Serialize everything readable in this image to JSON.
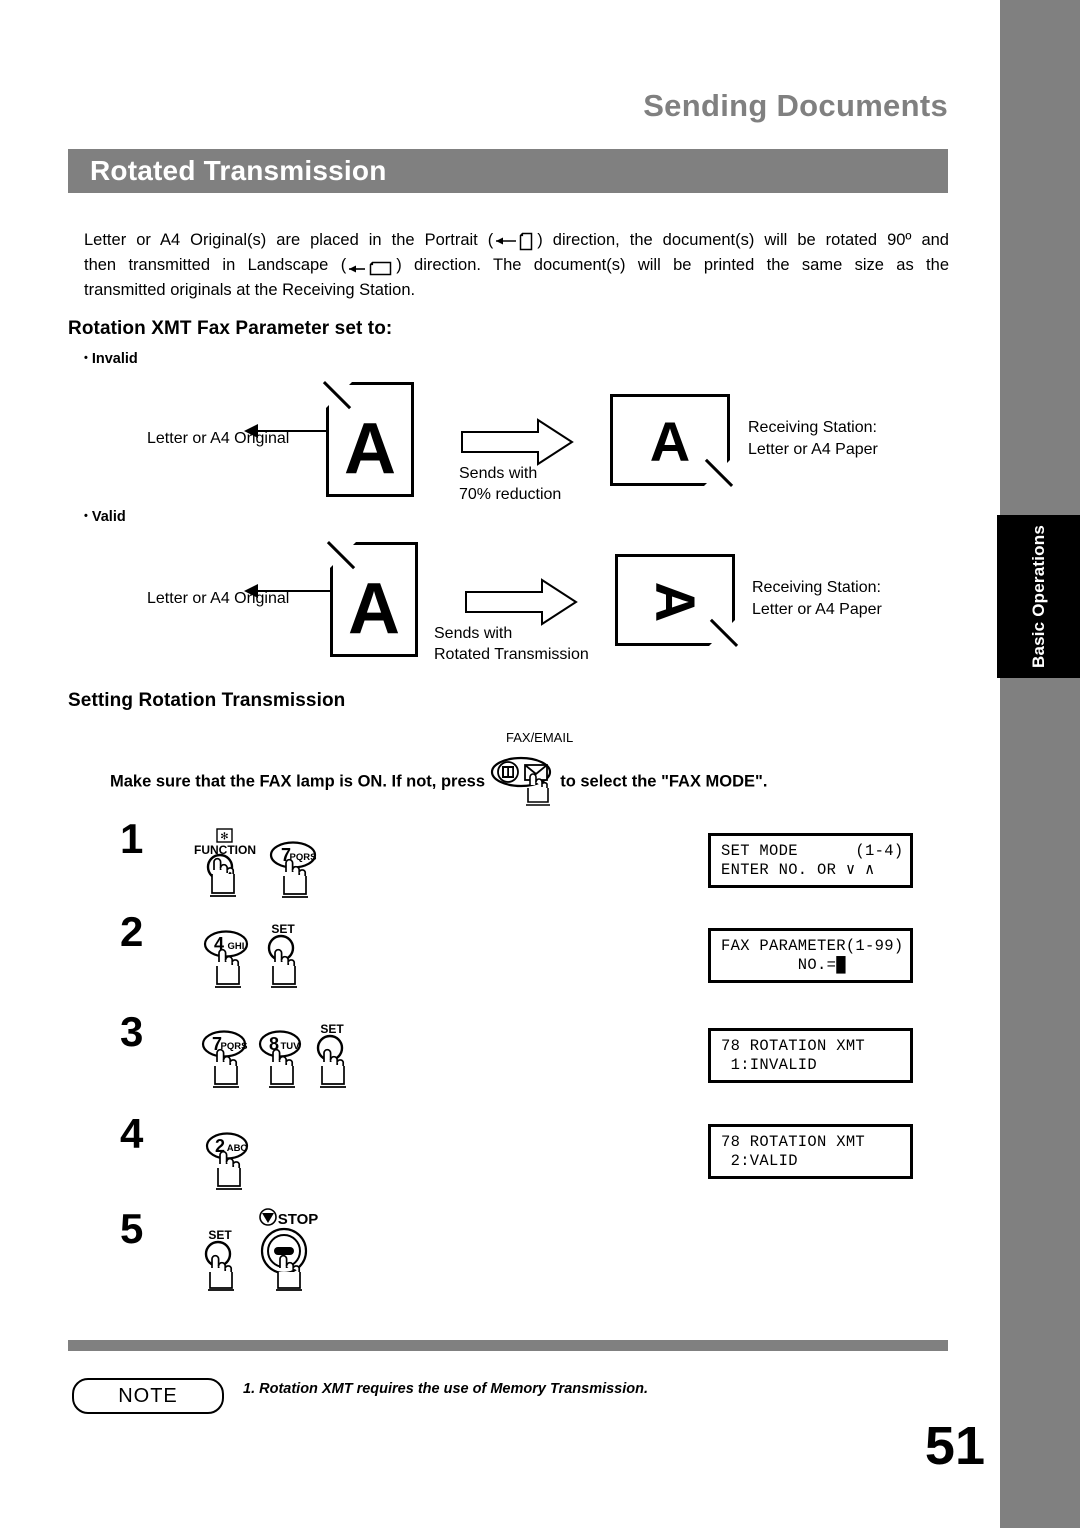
{
  "header": {
    "running_head": "Sending Documents",
    "section_title": "Rotated Transmission"
  },
  "side_tab": {
    "label": "Basic Operations"
  },
  "intro": {
    "line1_a": "Letter or A4 Original(s) are placed in the Portrait (",
    "line1_icon": "portrait-page-icon",
    "line1_b": ") direction, the document(s) will be rotated 90º and",
    "line2_a": "then  transmitted  in  Landscape  (",
    "line2_icon": "landscape-page-icon",
    "line2_b": ")  direction.  The  document(s)  will  be  printed  the  same  size  as  the",
    "line3": "transmitted originals at the Receiving Station."
  },
  "sections": {
    "parameter_heading": "Rotation XMT Fax Parameter set to:",
    "setting_heading": "Setting Rotation Transmission"
  },
  "diagrams": [
    {
      "bullet": "Invalid",
      "original_label": "Letter or A4 Original",
      "original_glyph": "A",
      "send_label_line1": "Sends with",
      "send_label_line2": "70% reduction",
      "result_glyph": "A",
      "result_rotated": false,
      "receiving_line1": "Receiving Station:",
      "receiving_line2": "Letter or A4 Paper"
    },
    {
      "bullet": "Valid",
      "original_label": "Letter or A4 Original",
      "original_glyph": "A",
      "send_label_line1": "Sends with",
      "send_label_line2": "Rotated Transmission",
      "result_glyph": "A",
      "result_rotated": true,
      "receiving_line1": "Receiving Station:",
      "receiving_line2": "Letter or A4 Paper"
    }
  ],
  "fax_lamp": {
    "text_before": "Make sure that the FAX lamp is ON.  If not, press",
    "button_caption": "FAX/EMAIL",
    "text_after": "to select the \"FAX MODE\"."
  },
  "steps": [
    {
      "number": "1",
      "keys": [
        {
          "type": "round",
          "label": "FUNCTION",
          "badge": "✻"
        },
        {
          "type": "oval",
          "digit": "7",
          "letters": "PQRS"
        }
      ],
      "lcd": {
        "line1": "SET MODE      (1-4)",
        "line2": "ENTER NO. OR ∨ ∧"
      }
    },
    {
      "number": "2",
      "keys": [
        {
          "type": "oval",
          "digit": "4",
          "letters": "GHI"
        },
        {
          "type": "round",
          "label": "SET"
        }
      ],
      "lcd": {
        "line1": "FAX PARAMETER(1-99)",
        "line2": "        NO.=█"
      }
    },
    {
      "number": "3",
      "keys": [
        {
          "type": "oval",
          "digit": "7",
          "letters": "PQRS"
        },
        {
          "type": "oval",
          "digit": "8",
          "letters": "TUV"
        },
        {
          "type": "round",
          "label": "SET"
        }
      ],
      "lcd": {
        "line1": "78 ROTATION XMT",
        "line2": " 1:INVALID"
      }
    },
    {
      "number": "4",
      "keys": [
        {
          "type": "oval",
          "digit": "2",
          "letters": "ABC"
        }
      ],
      "lcd": {
        "line1": "78 ROTATION XMT",
        "line2": " 2:VALID"
      }
    },
    {
      "number": "5",
      "keys": [
        {
          "type": "round",
          "label": "SET"
        },
        {
          "type": "stop",
          "label": "STOP"
        }
      ],
      "lcd": null
    }
  ],
  "footer": {
    "note_badge": "NOTE",
    "note_text": "1.  Rotation XMT requires the use of Memory Transmission.",
    "page_number": "51"
  },
  "colors": {
    "band_gray": "#808080",
    "tab_black": "#000000",
    "text_black": "#000000"
  }
}
